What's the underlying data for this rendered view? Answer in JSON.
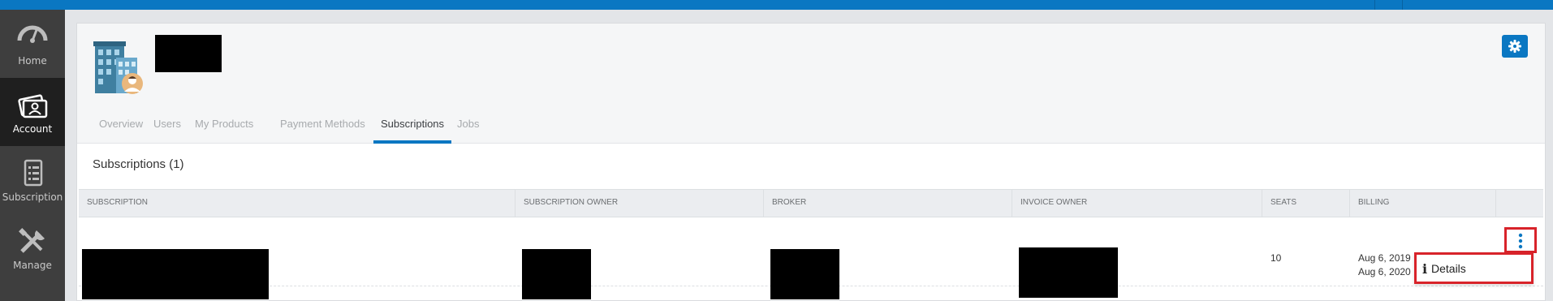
{
  "colors": {
    "accent": "#0a77c2",
    "sidebar_bg": "#3e3e3e",
    "sidebar_active": "#1f1f1f",
    "highlight_red": "#d8232a",
    "redaction": "#000000"
  },
  "sidebar": {
    "items": [
      {
        "label": "Home",
        "icon": "dashboard-gauge-icon",
        "active": false
      },
      {
        "label": "Account",
        "icon": "account-card-icon",
        "active": true
      },
      {
        "label": "Subscription",
        "icon": "subscription-document-icon",
        "active": false
      },
      {
        "label": "Manage",
        "icon": "tools-icon",
        "active": false
      }
    ]
  },
  "account": {
    "avatar_icon": "building-user-icon",
    "settings_icon": "gear-icon"
  },
  "tabs": [
    {
      "label": "Overview",
      "active": false
    },
    {
      "label": "Users",
      "active": false
    },
    {
      "label": "My Products",
      "active": false
    },
    {
      "label": "Payment Methods",
      "active": false
    },
    {
      "label": "Subscriptions",
      "active": true
    },
    {
      "label": "Jobs",
      "active": false
    }
  ],
  "subscriptions": {
    "title": "Subscriptions (1)",
    "columns": [
      "SUBSCRIPTION",
      "SUBSCRIPTION OWNER",
      "BROKER",
      "INVOICE OWNER",
      "SEATS",
      "BILLING"
    ],
    "rows": [
      {
        "seats": "10",
        "billing_start": "Aug 6, 2019",
        "billing_end": "Aug 6, 2020",
        "actions_icon": "vertical-ellipsis-icon"
      }
    ]
  },
  "row_menu": {
    "items": [
      {
        "label": "Details",
        "icon": "info-icon"
      }
    ]
  }
}
